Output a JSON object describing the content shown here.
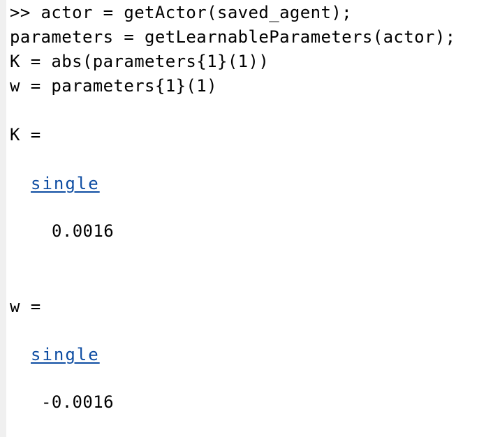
{
  "console": {
    "commands": [
      ">> actor = getActor(saved_agent);",
      "parameters = getLearnableParameters(actor);",
      "K = abs(parameters{1}(1))",
      "w = parameters{1}(1)"
    ],
    "outputs": [
      {
        "header": "K =",
        "type_link": "single",
        "value": "0.0016"
      },
      {
        "header": "w =",
        "type_link": "single",
        "value": "-0.0016"
      }
    ]
  },
  "colors": {
    "background": "#ffffff",
    "gutter": "#f0f0f0",
    "text": "#000000",
    "link": "#0e4da2"
  }
}
